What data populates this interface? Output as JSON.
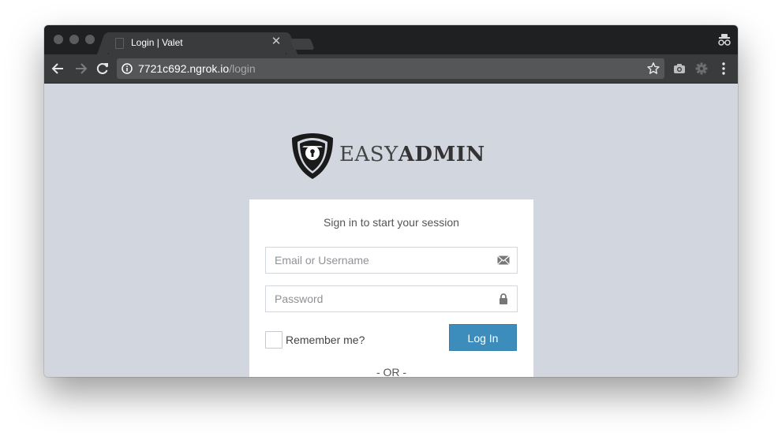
{
  "browser": {
    "tab": {
      "title": "Login | Valet",
      "close_glyph": "✕",
      "favicon": "document-icon"
    },
    "address_bar": {
      "host": "7721c692.ngrok.io",
      "path": "/login"
    },
    "icons": {
      "back": "arrow-left-icon",
      "forward": "arrow-right-icon",
      "reload": "reload-icon",
      "site_info": "info-icon",
      "bookmark": "star-icon",
      "camera_extension": "camera-icon",
      "settings_extension": "gear-icon",
      "menu": "vertical-dots-icon",
      "incognito": "incognito-icon"
    },
    "colors": {
      "tabstrip": "#1f2022",
      "toolbar": "#3a3b3d",
      "omnibox": "#555658"
    }
  },
  "page": {
    "logo": {
      "light_text": "EASY",
      "bold_text": "ADMIN",
      "icon": "shield-keyhole-icon"
    },
    "login": {
      "message": "Sign in to start your session",
      "email_placeholder": "Email or Username",
      "password_placeholder": "Password",
      "remember_label": "Remember me?",
      "submit_label": "Log In",
      "separator": "- OR -"
    },
    "colors": {
      "background": "#d2d6de",
      "primary_button": "#3c8dbc"
    }
  }
}
